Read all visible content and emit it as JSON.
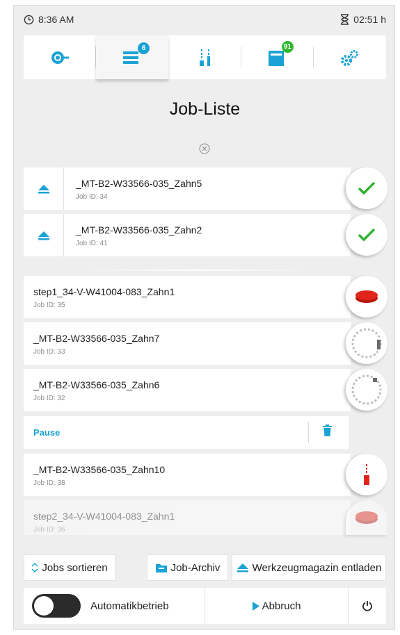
{
  "status": {
    "time": "8:36 AM",
    "elapsed": "02:51 h"
  },
  "nav": {
    "tabs": [
      {
        "icon": "machine-icon",
        "badge": ""
      },
      {
        "icon": "job-list-icon",
        "badge": "6"
      },
      {
        "icon": "tools-icon",
        "badge": ""
      },
      {
        "icon": "magazine-icon",
        "badge": "91"
      },
      {
        "icon": "settings-gears-icon",
        "badge": ""
      }
    ],
    "active_index": 1
  },
  "page": {
    "title": "Job-Liste"
  },
  "jobs_top": [
    {
      "name": "_MT-B2-W33566-035_Zahn5",
      "id": "Job ID: 34",
      "status_icon": "check-icon"
    },
    {
      "name": "_MT-B2-W33566-035_Zahn2",
      "id": "Job ID: 41",
      "status_icon": "check-icon"
    }
  ],
  "jobs_queue": [
    {
      "name": "step1_34-V-W41004-083_Zahn1",
      "id": "Job ID: 35",
      "status_icon": "disc-red-icon"
    },
    {
      "name": "_MT-B2-W33566-035_Zahn7",
      "id": "Job ID: 33",
      "status_icon": "tool-wheel-icon"
    },
    {
      "name": "_MT-B2-W33566-035_Zahn6",
      "id": "Job ID: 32",
      "status_icon": "tool-wheel-icon"
    }
  ],
  "pause": {
    "label": "Pause"
  },
  "jobs_after_pause": [
    {
      "name": "_MT-B2-W33566-035_Zahn10",
      "id": "Job ID: 38",
      "status_icon": "red-tool-icon"
    },
    {
      "name": "step2_34-V-W41004-083_Zahn1",
      "id": "Job ID: 36",
      "status_icon": "disc-red-icon"
    }
  ],
  "actions": {
    "sort": "Jobs sortieren",
    "archive": "Job-Archiv",
    "unload": "Werkzeugmagazin entladen"
  },
  "bottom": {
    "auto_label": "Automatikbetrieb",
    "auto_on": false,
    "abort": "Abbruch"
  },
  "colors": {
    "accent": "#1aa3d4",
    "check": "#34b233",
    "red": "#e0261b",
    "badge_blue": "#1aa3d4",
    "badge_green": "#2eb82e"
  }
}
